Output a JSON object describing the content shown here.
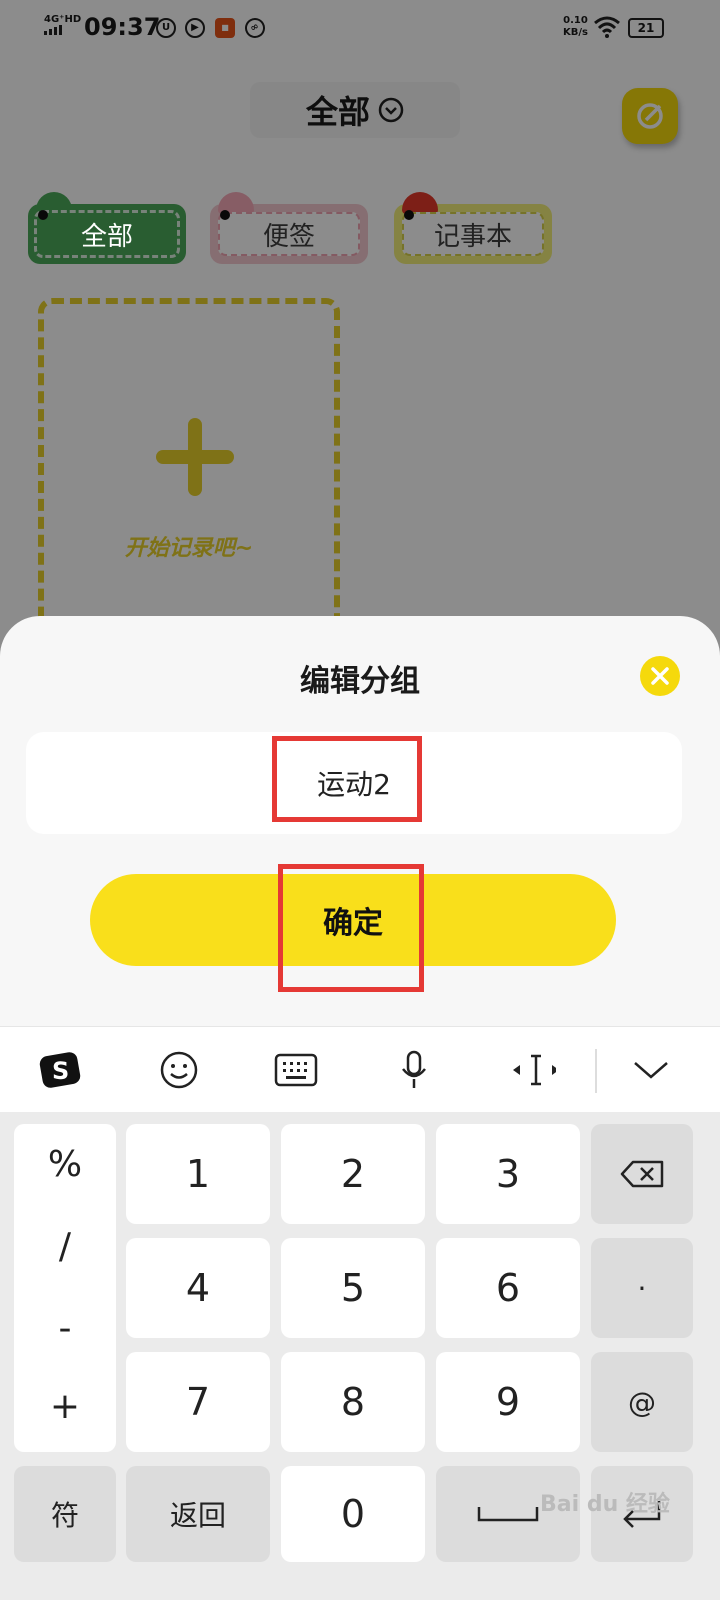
{
  "status_bar": {
    "network": "4G⁺HD",
    "time": "09:37",
    "speed_value": "0.10",
    "speed_unit": "KB/s",
    "battery": "21"
  },
  "header": {
    "title": "全部"
  },
  "category_chips": [
    {
      "label": "全部"
    },
    {
      "label": "便签"
    },
    {
      "label": "记事本"
    }
  ],
  "add_card": {
    "text": "开始记录吧~"
  },
  "dialog": {
    "title": "编辑分组",
    "input_value": "运动2",
    "confirm_label": "确定"
  },
  "keyboard": {
    "symbols": [
      "%",
      "/",
      "-",
      "+"
    ],
    "digits": [
      "1",
      "2",
      "3",
      "4",
      "5",
      "6",
      "7",
      "8",
      "9",
      "0"
    ],
    "dot": "·",
    "at": "@",
    "fu": "符",
    "back": "返回"
  },
  "watermark": "Bai du 经验",
  "colors": {
    "accent_yellow": "#f9df1b",
    "highlight_red": "#e53935",
    "chip_green": "#4caa5a"
  }
}
